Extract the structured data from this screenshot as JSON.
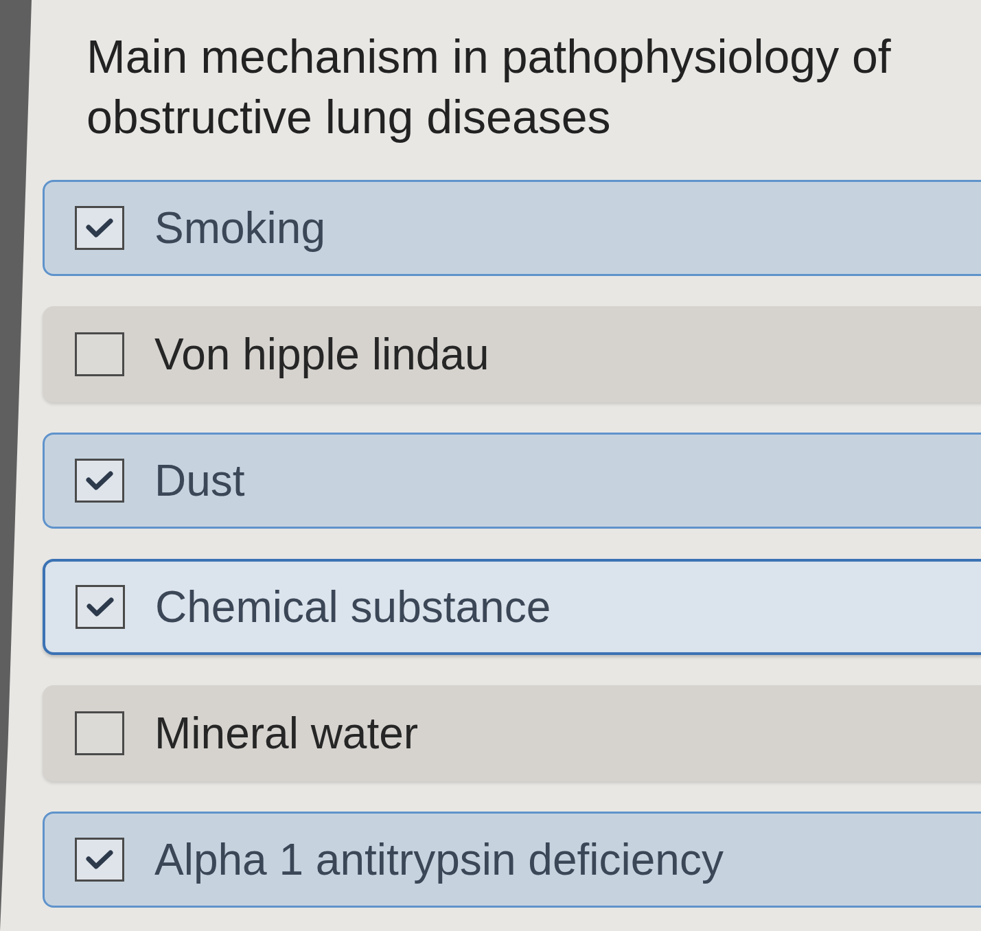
{
  "question": {
    "title": "Main mechanism in pathophysiology of obstructive lung diseases"
  },
  "options": [
    {
      "label": "Smoking",
      "checked": true,
      "focused": false
    },
    {
      "label": "Von hipple lindau",
      "checked": false,
      "focused": false
    },
    {
      "label": "Dust",
      "checked": true,
      "focused": false
    },
    {
      "label": "Chemical substance",
      "checked": true,
      "focused": true
    },
    {
      "label": "Mineral water",
      "checked": false,
      "focused": false
    },
    {
      "label": "Alpha 1 antitrypsin deficiency",
      "checked": true,
      "focused": false
    }
  ]
}
